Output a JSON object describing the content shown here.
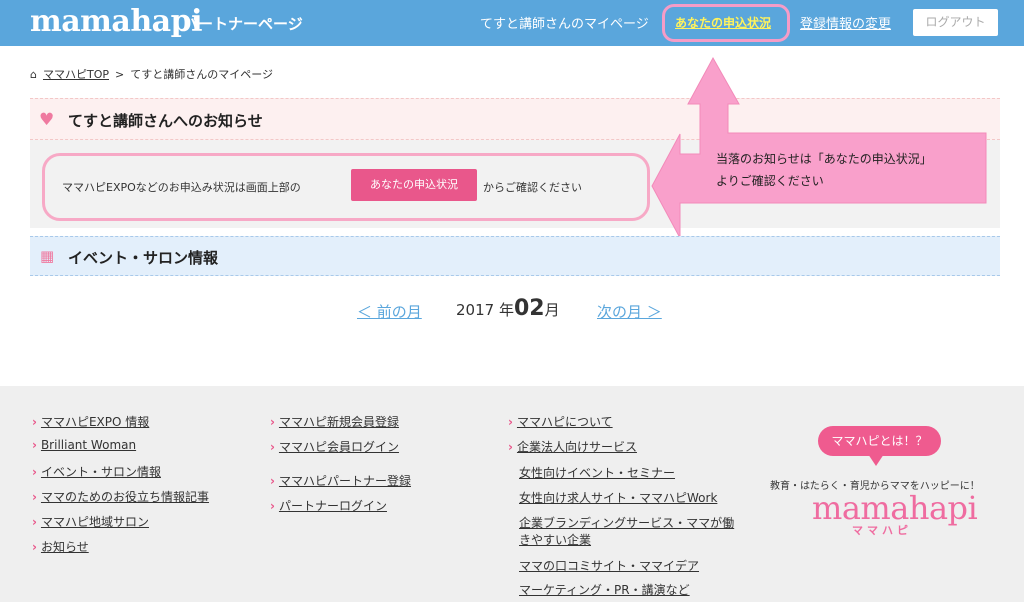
{
  "header": {
    "logo": "mamahapi",
    "logo_sub": "パートナーページ",
    "mypage_link": "てすと講師さんのマイページ",
    "apply_status_link": "あなたの申込状況",
    "registration_link": "登録情報の変更",
    "logout_button": "ログアウト"
  },
  "breadcrumb": {
    "home_icon": "home-icon",
    "top_link": "ママハピTOP",
    "separator": ">",
    "current": "てすと講師さんのマイページ"
  },
  "notice": {
    "title": "てすと講師さんへのお知らせ",
    "text_before": "ママハピEXPOなどのお申込み状況は画面上部の",
    "button_label": "あなたの申込状況",
    "text_after": "からご確認ください"
  },
  "callout": {
    "line1": "当落のお知らせは「あなたの申込状況」",
    "line2": "よりご確認ください"
  },
  "events": {
    "title": "イベント・サロン情報"
  },
  "month_nav": {
    "prev": "＜ 前の月",
    "year": "2017 年",
    "month": "02",
    "month_unit": "月",
    "next": "次の月 ＞"
  },
  "footer": {
    "col1": [
      "ママハピEXPO 情報",
      "Brilliant Woman",
      "イベント・サロン情報",
      "ママのためのお役立ち情報記事",
      "ママハピ地域サロン",
      "お知らせ"
    ],
    "col2": [
      "ママハピ新規会員登録",
      "ママハピ会員ログイン",
      "ママハピパートナー登録",
      "パートナーログイン"
    ],
    "col3_main": [
      "ママハピについて",
      "企業法人向けサービス"
    ],
    "col3_sub": [
      "女性向けイベント・セミナー",
      "女性向け求人サイト・ママハピWork",
      "企業ブランディングサービス・ママが働",
      "きやすい企業",
      "ママの口コミサイト・ママイデア",
      "マーケティング・PR・講演など"
    ],
    "bubble": "ママハピとは！？",
    "tagline": "教育・はたらく・育児からママをハッピーに！",
    "logo": "mamahapi",
    "logo_kana": "ママハピ"
  },
  "colors": {
    "header_bg": "#5aa6dc",
    "accent_pink": "#e9578b",
    "highlight_yellow": "#fff35c"
  }
}
